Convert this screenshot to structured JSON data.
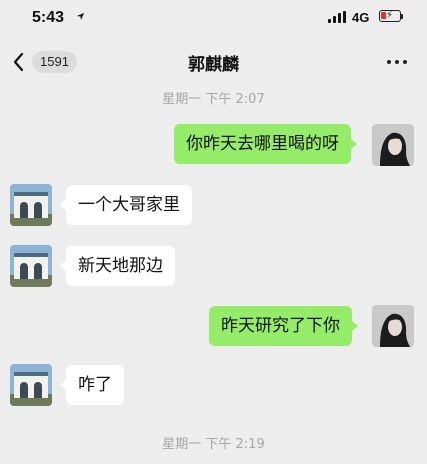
{
  "status_bar": {
    "time": "5:43",
    "network": "4G"
  },
  "header": {
    "back_badge": "1591",
    "title": "郭麒麟"
  },
  "messages": [
    {
      "type": "time",
      "text": "星期一 下午 2:07"
    },
    {
      "type": "msg",
      "side": "right",
      "text": "你昨天去哪里喝的呀"
    },
    {
      "type": "msg",
      "side": "left",
      "text": "一个大哥家里"
    },
    {
      "type": "msg",
      "side": "left",
      "text": "新天地那边"
    },
    {
      "type": "msg",
      "side": "right",
      "text": "昨天研究了下你"
    },
    {
      "type": "msg",
      "side": "left",
      "text": "咋了"
    },
    {
      "type": "time",
      "text": "星期一 下午 2:19"
    }
  ],
  "colors": {
    "background": "#ededed",
    "bubble_self": "#95ec69",
    "bubble_other": "#ffffff",
    "timestamp": "#a6a6a6"
  },
  "icons": [
    "location-arrow-icon",
    "signal-icon",
    "battery-charging-icon",
    "back-chevron-icon",
    "more-dots-icon"
  ]
}
